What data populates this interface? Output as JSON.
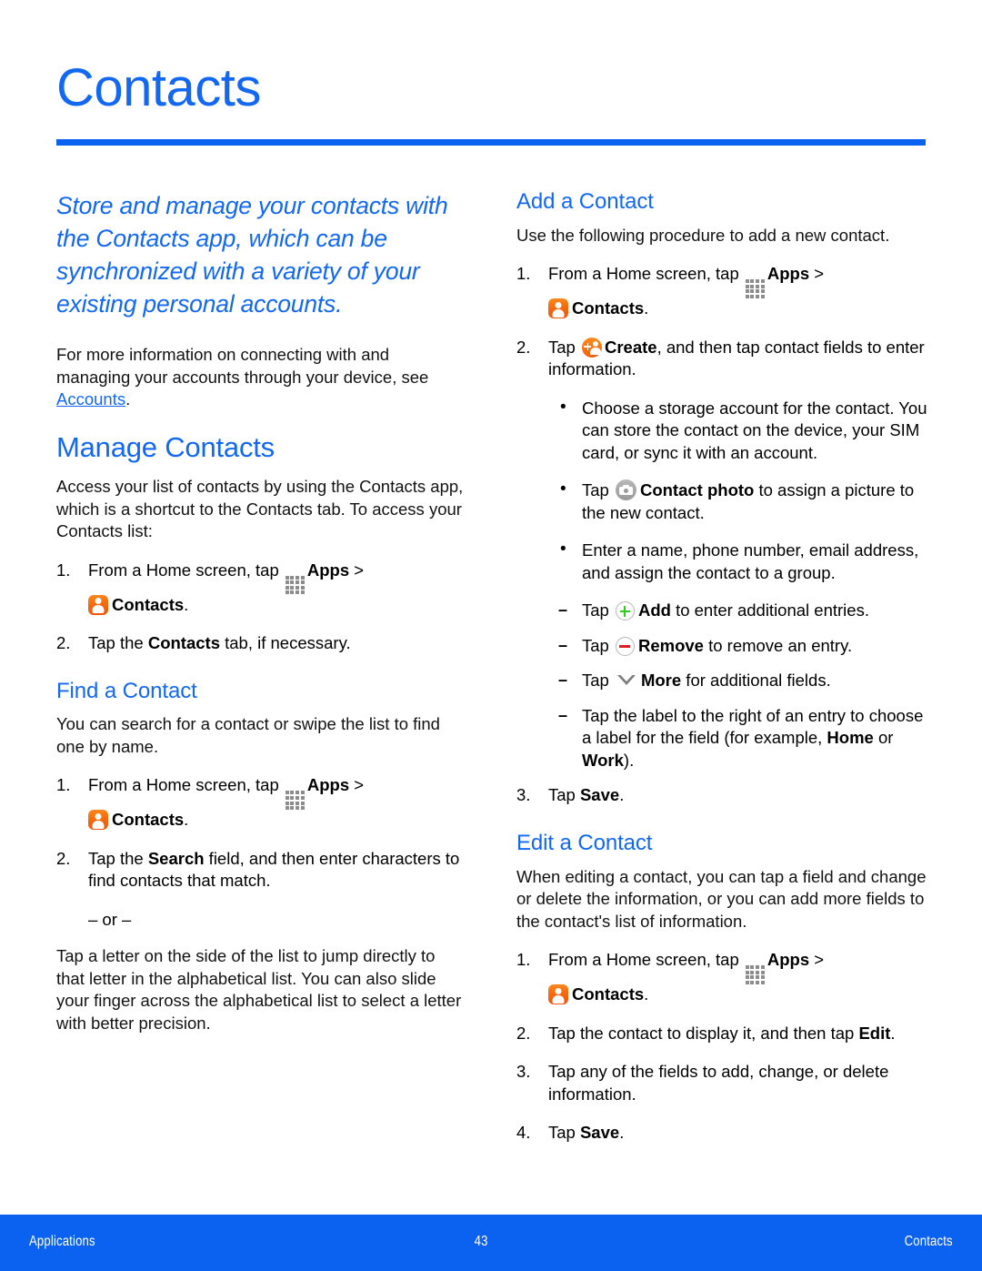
{
  "header": {
    "title": "Contacts"
  },
  "left_column": {
    "lede": "Store and manage your contacts with the Contacts app, which can be synchronized with a variety of your existing personal accounts.",
    "intro_para_pre": "For more information on connecting with and managing your accounts through your device, see ",
    "intro_link": "Accounts",
    "intro_para_post": ".",
    "manage_heading": "Manage Contacts",
    "manage_para": "Access your list of contacts by using the Contacts app, which is a shortcut to the Contacts tab. To access your Contacts list:",
    "manage_steps": [
      {
        "num": "1.",
        "pre": "From a Home screen, tap ",
        "apps_label": "Apps",
        "mid": " > ",
        "contacts_label": "Contacts",
        "post": "."
      },
      {
        "num": "2.",
        "pre": "Tap the ",
        "bold": "Contacts",
        "post": " tab, if necessary."
      }
    ],
    "find_heading": "Find a Contact",
    "find_para": "You can search for a contact or swipe the list to find one by name.",
    "find_steps": [
      {
        "num": "1.",
        "pre": "From a Home screen, tap ",
        "apps_label": "Apps",
        "mid": " > ",
        "contacts_label": "Contacts",
        "post": "."
      },
      {
        "num": "2.",
        "pre": "Tap the ",
        "bold": "Search",
        "post": " field, and then enter characters to find contacts that match."
      }
    ],
    "or_separator": "– or –",
    "find_alt_para": "Tap a letter on the side of the list to jump directly to that letter in the alphabetical list. You can also slide your finger across the alphabetical list to select a letter with better precision."
  },
  "right_column": {
    "add_heading": "Add a Contact",
    "add_para": "Use the following procedure to add a new contact.",
    "add_step1": {
      "num": "1.",
      "pre": "From a Home screen, tap ",
      "apps_label": "Apps",
      "mid": " > ",
      "contacts_label": "Contacts",
      "post": "."
    },
    "add_step2": {
      "num": "2.",
      "pre": "Tap ",
      "create_label": "Create",
      "post": ", and then tap contact fields to enter information."
    },
    "add_bullets": [
      {
        "text": "Choose a storage account for the contact. You can store the contact on the device, your SIM card, or sync it with an account."
      },
      {
        "pre": "Tap ",
        "bold": "Contact photo",
        "post": " to assign a picture to the new contact."
      },
      {
        "text": "Enter a name, phone number, email address, and assign the contact to a group."
      }
    ],
    "add_dashes": [
      {
        "pre": "Tap ",
        "bold": "Add",
        "post": " to enter additional entries."
      },
      {
        "pre": "Tap ",
        "bold": "Remove",
        "post": " to remove an entry."
      },
      {
        "pre": "Tap ",
        "bold": "More",
        "post": " for additional fields."
      },
      {
        "pre": "Tap the label to the right of an entry to choose a label for the field (for example, ",
        "bold": "Home",
        "mid": " or ",
        "bold2": "Work",
        "post": ")."
      }
    ],
    "add_step3": {
      "num": "3.",
      "pre": "Tap ",
      "bold": "Save",
      "post": "."
    },
    "edit_heading": "Edit a Contact",
    "edit_para": "When editing a contact, you can tap a field and change or delete the information, or you can add more fields to the contact's list of information.",
    "edit_step1": {
      "num": "1.",
      "pre": "From a Home screen, tap ",
      "apps_label": "Apps",
      "mid": " > ",
      "contacts_label": "Contacts",
      "post": "."
    },
    "edit_step2": {
      "num": "2.",
      "pre": "Tap the contact to display it, and then tap ",
      "bold": "Edit",
      "post": "."
    },
    "edit_step3": {
      "num": "3.",
      "text": "Tap any of the fields to add, change, or delete information."
    },
    "edit_step4": {
      "num": "4.",
      "pre": "Tap ",
      "bold": "Save",
      "post": "."
    }
  },
  "footer": {
    "left": "Applications",
    "page_number": "43",
    "right": "Contacts"
  },
  "colors": {
    "accent_blue": "#1268F3",
    "rule_blue": "#0B62F0",
    "footer_blue": "#0B62F0",
    "app_orange": "#F8760F",
    "add_green": "#2FCB1F",
    "remove_red": "#E01B24",
    "icon_gray": "#8c8c8c"
  }
}
